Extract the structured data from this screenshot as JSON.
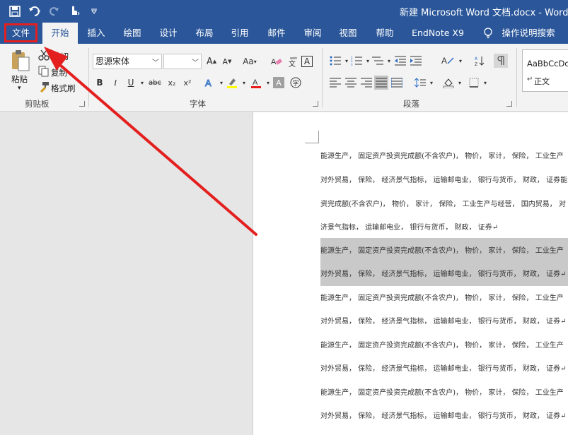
{
  "titlebar": {
    "title": "新建 Microsoft Word 文档.docx - Word",
    "qat": {
      "save_icon": "save-icon",
      "undo_icon": "undo-icon",
      "redo_icon": "redo-icon",
      "touch_icon": "touch-mode-icon",
      "customize_icon": "customize-qat-icon"
    }
  },
  "tabs": [
    {
      "label": "文件"
    },
    {
      "label": "开始"
    },
    {
      "label": "插入"
    },
    {
      "label": "绘图"
    },
    {
      "label": "设计"
    },
    {
      "label": "布局"
    },
    {
      "label": "引用"
    },
    {
      "label": "邮件"
    },
    {
      "label": "审阅"
    },
    {
      "label": "视图"
    },
    {
      "label": "帮助"
    },
    {
      "label": "EndNote X9"
    },
    {
      "label": "操作说明搜索"
    }
  ],
  "clipboard": {
    "paste_label": "粘贴",
    "cut_label": "剪切",
    "copy_label": "复制",
    "format_painter_label": "格式刷",
    "group_label": "剪贴板"
  },
  "font": {
    "font_name": "思源宋体",
    "font_size": "",
    "group_label": "字体",
    "bold": "B",
    "italic": "I",
    "underline": "U",
    "strike": "abc",
    "subscript": "x₂",
    "superscript": "x²",
    "grow": "A",
    "shrink": "A",
    "change_case": "Aa",
    "char_border": "A"
  },
  "paragraph": {
    "group_label": "段落"
  },
  "styles": {
    "sample": "AaBbCcDc",
    "name": "正文"
  },
  "document": {
    "lines": [
      "能源生产， 固定资产投资完成额(不含农户)， 物价， 家计， 保险， 工业生产",
      "对外贸易， 保险， 经济景气指标， 运输邮电业， 银行与货币， 财政， 证券能",
      "资完成额(不含农户)， 物价， 家计， 保险， 工业生产与经营， 国内贸易， 对",
      "济景气指标， 运输邮电业， 银行与货币， 财政， 证券↵",
      "能源生产， 固定资产投资完成额(不含农户)， 物价， 家计， 保险， 工业生产",
      "对外贸易， 保险， 经济景气指标， 运输邮电业， 银行与货币， 财政， 证券↵",
      "能源生产， 固定资产投资完成额(不含农户)， 物价， 家计， 保险， 工业生产",
      "对外贸易， 保险， 经济景气指标， 运输邮电业， 银行与货币， 财政， 证券↵",
      "能源生产， 固定资产投资完成额(不含农户)， 物价， 家计， 保险， 工业生产",
      "对外贸易， 保险， 经济景气指标， 运输邮电业， 银行与货币， 财政， 证券↵",
      "能源生产， 固定资产投资完成额(不含农户)， 物价， 家计， 保险， 工业生产",
      "对外贸易， 保险， 经济景气指标， 运输邮电业， 银行与货币， 财政， 证券↵"
    ]
  },
  "colors": {
    "brand": "#2b579a",
    "ribbon": "#f3f3f3",
    "highlight_box": "#e3201f",
    "selection": "#c9c9c9"
  }
}
